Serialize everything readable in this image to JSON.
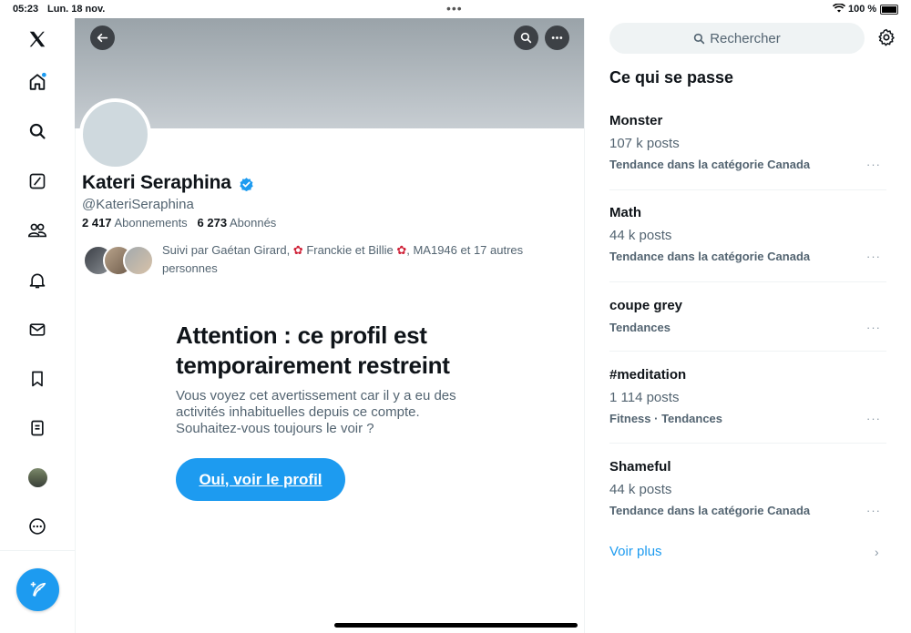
{
  "status_bar": {
    "time": "05:23",
    "date": "Lun. 18 nov.",
    "battery": "100 %"
  },
  "nav": {
    "items": [
      "x-logo",
      "home",
      "explore",
      "grok",
      "notifications",
      "messages",
      "bookmarks",
      "lists",
      "profile",
      "more"
    ],
    "home_has_notification_dot": true
  },
  "profile": {
    "name": "Kateri Seraphina",
    "handle": "@KateriSeraphina",
    "following_count": "2 417",
    "following_label": "Abonnements",
    "followers_count": "6 273",
    "followers_label": "Abonnés",
    "followed_by": {
      "prefix": "Suivi par Gaétan Girard, ",
      "name2": "Franckie et Billie",
      "name3": ", MA1946 et 17 autres personnes"
    },
    "warning": {
      "title": "Attention : ce profil est temporairement restreint",
      "body": "Vous voyez cet avertissement car il y a eu des activités inhabituelles depuis ce compte. Souhaitez-vous toujours le voir ?",
      "button": "Oui, voir le profil"
    }
  },
  "sidebar": {
    "search_placeholder": "Rechercher",
    "section_title": "Ce qui se passe",
    "trends": [
      {
        "name": "Monster",
        "posts": "107 k posts",
        "category": "Tendance dans la catégorie Canada"
      },
      {
        "name": "Math",
        "posts": "44 k posts",
        "category": "Tendance dans la catégorie Canada"
      },
      {
        "name": "coupe grey",
        "posts": "",
        "category": "Tendances"
      },
      {
        "name": "#meditation",
        "posts": "1 114 posts",
        "category": "Fitness · Tendances"
      },
      {
        "name": "Shameful",
        "posts": "44 k posts",
        "category": "Tendance dans la catégorie Canada"
      }
    ],
    "see_more": "Voir plus"
  },
  "colors": {
    "accent": "#1d9bf0",
    "text": "#0f1419",
    "muted": "#536471",
    "border": "#eff3f4"
  }
}
